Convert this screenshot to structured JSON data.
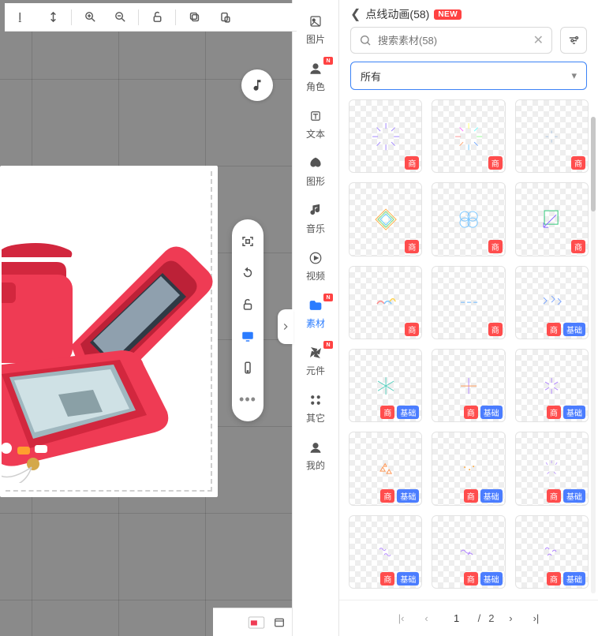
{
  "toolbar_top": [
    "align-bottom",
    "align-center-h",
    "zoom-in",
    "zoom-out",
    "lock-open",
    "copy",
    "paste"
  ],
  "float_tools": [
    "fit-screen",
    "rotate",
    "lock-open",
    "desktop",
    "mobile",
    "more"
  ],
  "vnav": {
    "items": [
      {
        "label": "图片",
        "icon": "image"
      },
      {
        "label": "角色",
        "icon": "person",
        "new": true
      },
      {
        "label": "文本",
        "icon": "text"
      },
      {
        "label": "图形",
        "icon": "shape"
      },
      {
        "label": "音乐",
        "icon": "music"
      },
      {
        "label": "视频",
        "icon": "video"
      },
      {
        "label": "素材",
        "icon": "folder",
        "new": true,
        "active": true
      },
      {
        "label": "元件",
        "icon": "pinwheel",
        "new": true
      },
      {
        "label": "其它",
        "icon": "grid"
      },
      {
        "label": "我的",
        "icon": "user"
      }
    ]
  },
  "panel": {
    "back_aria": "返回",
    "title": "点线动画(58)",
    "new_badge": "NEW",
    "search_placeholder": "搜索素材(58)",
    "select_value": "所有",
    "tag_shang": "商",
    "tag_jichu": "基础",
    "thumbs": [
      {
        "shang": true,
        "jichu": false,
        "g": "burst-purple"
      },
      {
        "shang": true,
        "jichu": false,
        "g": "burst-color"
      },
      {
        "shang": true,
        "jichu": false,
        "g": "burst-tiny"
      },
      {
        "shang": true,
        "jichu": false,
        "g": "diamond"
      },
      {
        "shang": true,
        "jichu": false,
        "g": "flower"
      },
      {
        "shang": true,
        "jichu": false,
        "g": "arrow-sq"
      },
      {
        "shang": true,
        "jichu": false,
        "g": "wave-color"
      },
      {
        "shang": true,
        "jichu": false,
        "g": "dashes"
      },
      {
        "shang": true,
        "jichu": true,
        "g": "zigzag"
      },
      {
        "shang": true,
        "jichu": true,
        "g": "star6"
      },
      {
        "shang": true,
        "jichu": true,
        "g": "plus"
      },
      {
        "shang": true,
        "jichu": true,
        "g": "spark"
      },
      {
        "shang": true,
        "jichu": true,
        "g": "tri3"
      },
      {
        "shang": true,
        "jichu": true,
        "g": "dots3"
      },
      {
        "shang": true,
        "jichu": true,
        "g": "sparks-sm"
      },
      {
        "shang": true,
        "jichu": true,
        "g": "squiggles"
      },
      {
        "shang": true,
        "jichu": true,
        "g": "waves2"
      },
      {
        "shang": true,
        "jichu": true,
        "g": "squiggles2"
      }
    ],
    "page_current": "1",
    "page_sep": "/",
    "page_total": "2"
  }
}
